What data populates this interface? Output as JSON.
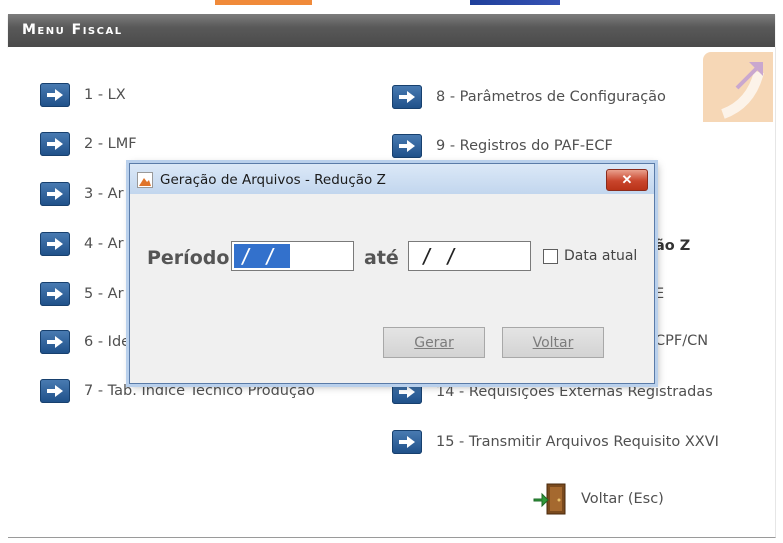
{
  "header": {
    "title": "Menu Fiscal"
  },
  "menu_left": [
    {
      "label": "1 - LX"
    },
    {
      "label": "2 - LMF"
    },
    {
      "label": "3 - Ar"
    },
    {
      "label": "4 - Ar"
    },
    {
      "label": "5 - Ar"
    },
    {
      "label": "6 - Ide"
    },
    {
      "label": "7 - Tab. Índice Técnico Produção"
    }
  ],
  "menu_right": [
    {
      "label": "8 - Parâmetros de Configuração"
    },
    {
      "label": "9 - Registros do PAF-ECF"
    },
    {
      "label": "ão Z"
    },
    {
      "label": "E"
    },
    {
      "label": "CPF/CN"
    },
    {
      "label": "14 - Requisições Externas Registradas"
    },
    {
      "label": "15 - Transmitir Arquivos Requisito XXVI"
    }
  ],
  "exit": {
    "label": "Voltar (Esc)"
  },
  "dialog": {
    "title": "Geração de Arquivos - Redução Z",
    "periodo_label": "Período",
    "ate_label": "até",
    "start_date": "/ /",
    "end_date": "/ /",
    "checkbox_label": "Data atual",
    "gerar_label": "Gerar",
    "voltar_label": "Voltar",
    "close_symbol": "✕"
  }
}
